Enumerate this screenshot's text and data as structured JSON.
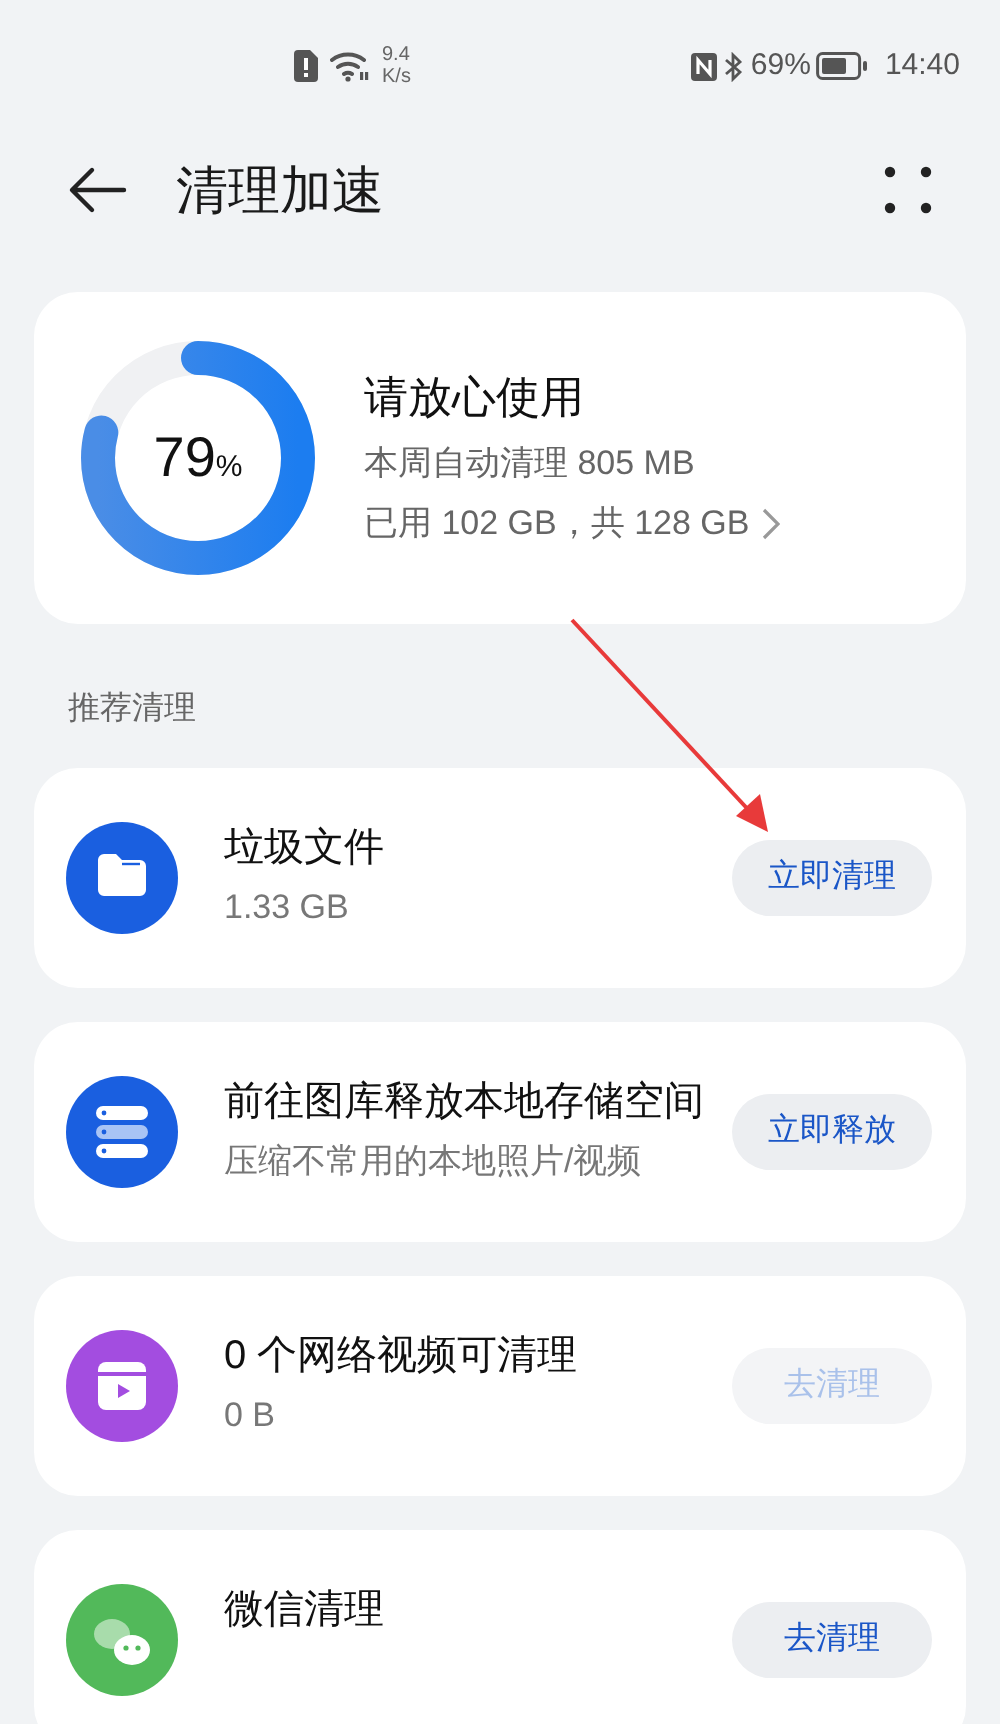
{
  "status_bar": {
    "speed_value": "9.4",
    "speed_unit": "K/s",
    "battery": "69%",
    "time": "14:40"
  },
  "header": {
    "title": "清理加速"
  },
  "storage": {
    "percent": "79",
    "percent_sign": "%",
    "level": 0.79,
    "title": "请放心使用",
    "weekly": "本周自动清理 805 MB",
    "usage": "已用 102 GB，共 128 GB"
  },
  "section_title": "推荐清理",
  "items": [
    {
      "kind": "folder",
      "title": "垃圾文件",
      "subtitle": "1.33 GB",
      "button": "立即清理",
      "disabled": false
    },
    {
      "kind": "storage",
      "title": "前往图库释放本地存储空间",
      "subtitle": "压缩不常用的本地照片/视频",
      "button": "立即释放",
      "disabled": false
    },
    {
      "kind": "video",
      "title": "0 个网络视频可清理",
      "subtitle": "0 B",
      "button": "去清理",
      "disabled": true
    },
    {
      "kind": "chat",
      "title": "微信清理",
      "button": "去清理",
      "disabled": false
    }
  ]
}
